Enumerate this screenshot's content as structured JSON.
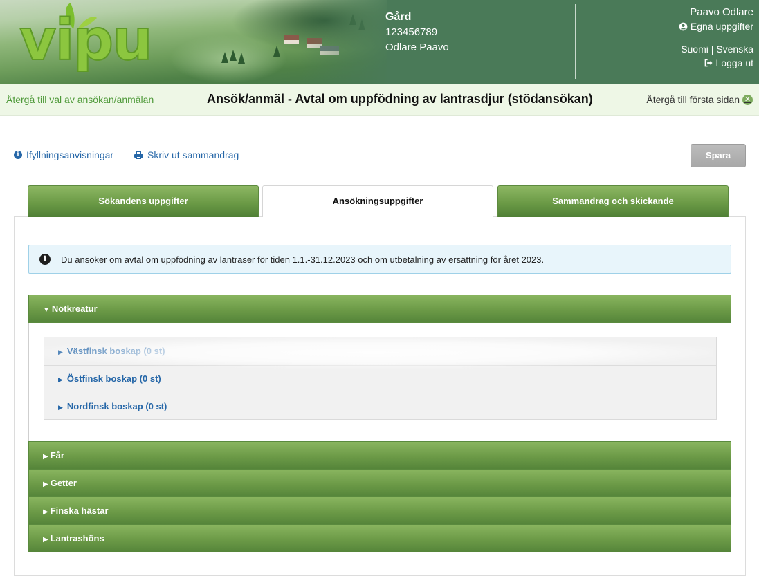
{
  "header": {
    "logo_text": "vipu",
    "farm": {
      "title": "Gård",
      "id": "123456789",
      "name": "Odlare Paavo"
    },
    "user": {
      "name": "Paavo Odlare",
      "own_info_label": "Egna uppgifter",
      "lang_suomi": "Suomi",
      "lang_sep": "|",
      "lang_svenska": "Svenska",
      "logout_label": "Logga ut"
    }
  },
  "title_bar": {
    "back_link": "Återgå till val av ansökan/anmälan",
    "title": "Ansök/anmäl - Avtal om uppfödning av lantrasdjur (stödansökan)",
    "home_link": "Återgå till första sidan"
  },
  "toolbar": {
    "instructions_label": "Ifyllningsanvisningar",
    "print_label": "Skriv ut sammandrag",
    "save_label": "Spara"
  },
  "tabs": [
    {
      "label": "Sökandens uppgifter",
      "active": false
    },
    {
      "label": "Ansökningsuppgifter",
      "active": true
    },
    {
      "label": "Sammandrag och skickande",
      "active": false
    }
  ],
  "info_alert": {
    "text": "Du ansöker om avtal om uppfödning av lantraser för tiden 1.1.-31.12.2023 och om utbetalning av ersättning för året 2023."
  },
  "accordion": {
    "sections": [
      {
        "label": "Nötkreatur",
        "expanded": true
      },
      {
        "label": "Får",
        "expanded": false
      },
      {
        "label": "Getter",
        "expanded": false
      },
      {
        "label": "Finska hästar",
        "expanded": false
      },
      {
        "label": "Lantrashöns",
        "expanded": false
      }
    ],
    "cattle_breeds": [
      {
        "label": "Västfinsk boskap (0 st)"
      },
      {
        "label": "Östfinsk boskap (0 st)"
      },
      {
        "label": "Nordfinsk boskap (0 st)"
      }
    ]
  },
  "colors": {
    "header_green": "#4a7a58",
    "accent_green": "#6c9a47",
    "link_blue": "#2667a8",
    "title_bar_bg": "#eef7e6",
    "alert_bg": "#e8f5fb"
  },
  "icons": [
    "user-circle-icon",
    "logout-icon",
    "close-circle-icon",
    "info-icon",
    "printer-icon",
    "caret-down-icon",
    "caret-right-icon"
  ]
}
